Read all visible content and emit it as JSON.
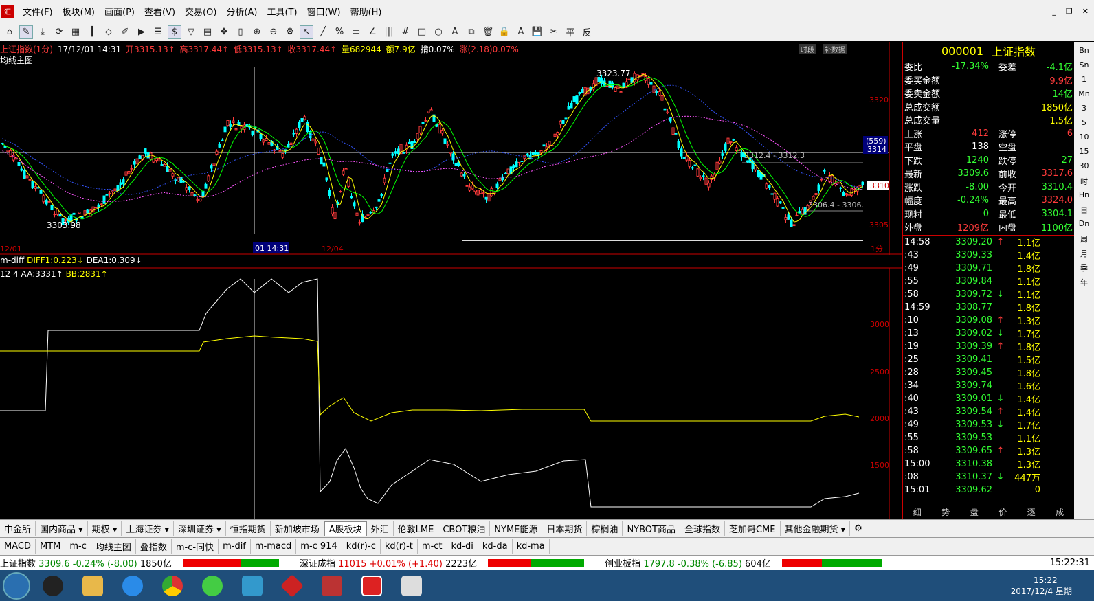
{
  "menu": {
    "logo": "汇",
    "items": [
      "文件(F)",
      "板块(M)",
      "画面(P)",
      "查看(V)",
      "交易(O)",
      "分析(A)",
      "工具(T)",
      "窗口(W)",
      "帮助(H)"
    ]
  },
  "chart_info": {
    "name": "上证指数(1分)",
    "datetime": "17/12/01 14:31",
    "open": "开3315.13↑",
    "high": "高3317.44↑",
    "low": "低3315.13↑",
    "close": "收3317.44↑",
    "volume": "量682944",
    "amount": "额7.9亿",
    "amplitude": "掯0.07%",
    "change": "涨(2.18)0.07%",
    "subtitle": "均线主图",
    "btn_time": "时段",
    "btn_fill": "补数据"
  },
  "price_chart": {
    "annotations": {
      "high_label": "3323.77",
      "low_label": "3303.98",
      "range1": "3312.4 - 3312.3",
      "range2": "3306.4 - 3306.",
      "date_left": "12/01",
      "date_cursor": "01 14:31",
      "date_mid": "12/04",
      "period": "1分",
      "yaxis_labels": [
        "3320",
        "3314",
        "3310",
        "3305"
      ],
      "cursor_box": "(559)",
      "price_box": "3310"
    }
  },
  "indicator1": {
    "label": "m-diff",
    "diff": "DIFF1:0.223↓",
    "dea": "DEA1:0.309↓"
  },
  "indicator2": {
    "params": "12 4",
    "aa": "AA:3331↑",
    "bb": "BB:2831↑",
    "yaxis_labels": [
      "3000",
      "2500",
      "2000",
      "1500"
    ]
  },
  "sidebar": {
    "code": "000001",
    "name": "上证指数",
    "rows": [
      {
        "l1": "委比",
        "v1": "-17.34%",
        "l2": "委差",
        "v2": "-4.1亿"
      },
      {
        "l1": "委买金额",
        "v1": "",
        "l2": "",
        "v2": "9.9亿"
      },
      {
        "l1": "委卖金额",
        "v1": "",
        "l2": "",
        "v2": "14亿"
      },
      {
        "l1": "总成交额",
        "v1": "",
        "l2": "",
        "v2": "1850亿"
      },
      {
        "l1": "总成交量",
        "v1": "",
        "l2": "",
        "v2": "1.5亿"
      },
      {
        "l1": "上涨",
        "v1": "412",
        "l2": "涨停",
        "v2": "6"
      },
      {
        "l1": "平盘",
        "v1": "138",
        "l2": "空盘",
        "v2": ""
      },
      {
        "l1": "下跌",
        "v1": "1240",
        "l2": "跌停",
        "v2": "27"
      },
      {
        "l1": "最新",
        "v1": "3309.6",
        "l2": "前收",
        "v2": "3317.6"
      },
      {
        "l1": "涨跌",
        "v1": "-8.00",
        "l2": "今开",
        "v2": "3310.4"
      },
      {
        "l1": "幅度",
        "v1": "-0.24%",
        "l2": "最高",
        "v2": "3324.0"
      },
      {
        "l1": "现籿",
        "v1": "0",
        "l2": "最低",
        "v2": "3304.1"
      },
      {
        "l1": "外盘",
        "v1": "1209亿",
        "l2": "内盘",
        "v2": "1100亿"
      }
    ],
    "ticks": [
      {
        "t": "14:58",
        "p": "3309.20",
        "a": "↑",
        "v": "1.1亿"
      },
      {
        "t": ":43",
        "p": "3309.33",
        "a": "",
        "v": "1.4亿"
      },
      {
        "t": ":49",
        "p": "3309.71",
        "a": "",
        "v": "1.8亿"
      },
      {
        "t": ":55",
        "p": "3309.84",
        "a": "",
        "v": "1.1亿"
      },
      {
        "t": ":58",
        "p": "3309.72",
        "a": "↓",
        "v": "1.1亿"
      },
      {
        "t": "14:59",
        "p": "3308.77",
        "a": "",
        "v": "1.8亿"
      },
      {
        "t": ":10",
        "p": "3309.08",
        "a": "↑",
        "v": "1.3亿"
      },
      {
        "t": ":13",
        "p": "3309.02",
        "a": "↓",
        "v": "1.7亿"
      },
      {
        "t": ":19",
        "p": "3309.39",
        "a": "↑",
        "v": "1.8亿"
      },
      {
        "t": ":25",
        "p": "3309.41",
        "a": "",
        "v": "1.5亿"
      },
      {
        "t": ":28",
        "p": "3309.45",
        "a": "",
        "v": "1.8亿"
      },
      {
        "t": ":34",
        "p": "3309.74",
        "a": "",
        "v": "1.6亿"
      },
      {
        "t": ":40",
        "p": "3309.01",
        "a": "↓",
        "v": "1.4亿"
      },
      {
        "t": ":43",
        "p": "3309.54",
        "a": "↑",
        "v": "1.4亿"
      },
      {
        "t": ":49",
        "p": "3309.53",
        "a": "↓",
        "v": "1.7亿"
      },
      {
        "t": ":55",
        "p": "3309.53",
        "a": "",
        "v": "1.1亿"
      },
      {
        "t": ":58",
        "p": "3309.65",
        "a": "↑",
        "v": "1.3亿"
      },
      {
        "t": "15:00",
        "p": "3310.38",
        "a": "",
        "v": "1.3亿"
      },
      {
        "t": ":08",
        "p": "3310.37",
        "a": "↓",
        "v": "447万"
      },
      {
        "t": "15:01",
        "p": "3309.62",
        "a": "",
        "v": "0"
      }
    ],
    "bottom_tabs": [
      "细",
      "势",
      "盘",
      "价",
      "逐",
      "成"
    ]
  },
  "right_strip": [
    "Bn",
    "Sn",
    "1",
    "Mn",
    "3",
    "5",
    "10",
    "15",
    "30",
    "时",
    "Hn",
    "日",
    "Dn",
    "周",
    "月",
    "季",
    "年"
  ],
  "market_tabs": [
    "中金所",
    "国内商品 ▾",
    "期权 ▾",
    "上海证券 ▾",
    "深圳证券 ▾",
    "恒指期货",
    "新加坡市场",
    "A股板块",
    "外汇",
    "伦敦LME",
    "CBOT粮油",
    "NYME能源",
    "日本期货",
    "棕榈油",
    "NYBOT商品",
    "全球指数",
    "芝加哥CME",
    "其他金融期货 ▾"
  ],
  "indicator_tabs": [
    "MACD",
    "MTM",
    "m-c",
    "均线主图",
    "叠指数",
    "m-c-同快",
    "m-dif",
    "m-macd",
    "m-c 914",
    "kd(r)-c",
    "kd(r)-t",
    "m-ct",
    "kd-di",
    "kd-da",
    "kd-ma"
  ],
  "status_bar": {
    "sh": {
      "name": "上证指数",
      "val": "3309.6",
      "pct": "-0.24%",
      "chg": "(-8.00)",
      "amt": "1850亿"
    },
    "sz": {
      "name": "深证成指",
      "val": "11015",
      "pct": "+0.01%",
      "chg": "(+1.40)",
      "amt": "2223亿"
    },
    "cy": {
      "name": "创业板指",
      "val": "1797.8",
      "pct": "-0.38%",
      "chg": "(-6.85)",
      "amt": "604亿"
    },
    "clock": "15:22:31"
  },
  "taskbar": {
    "time": "15:22",
    "date": "2017/12/4 星期一"
  },
  "colors": {
    "up": "#ff3b3b",
    "down": "#33ff33",
    "ma5": "#ffff00",
    "ma10": "#00ff00",
    "ma60": "#3355ff",
    "ma_pink": "#ff55ff"
  }
}
